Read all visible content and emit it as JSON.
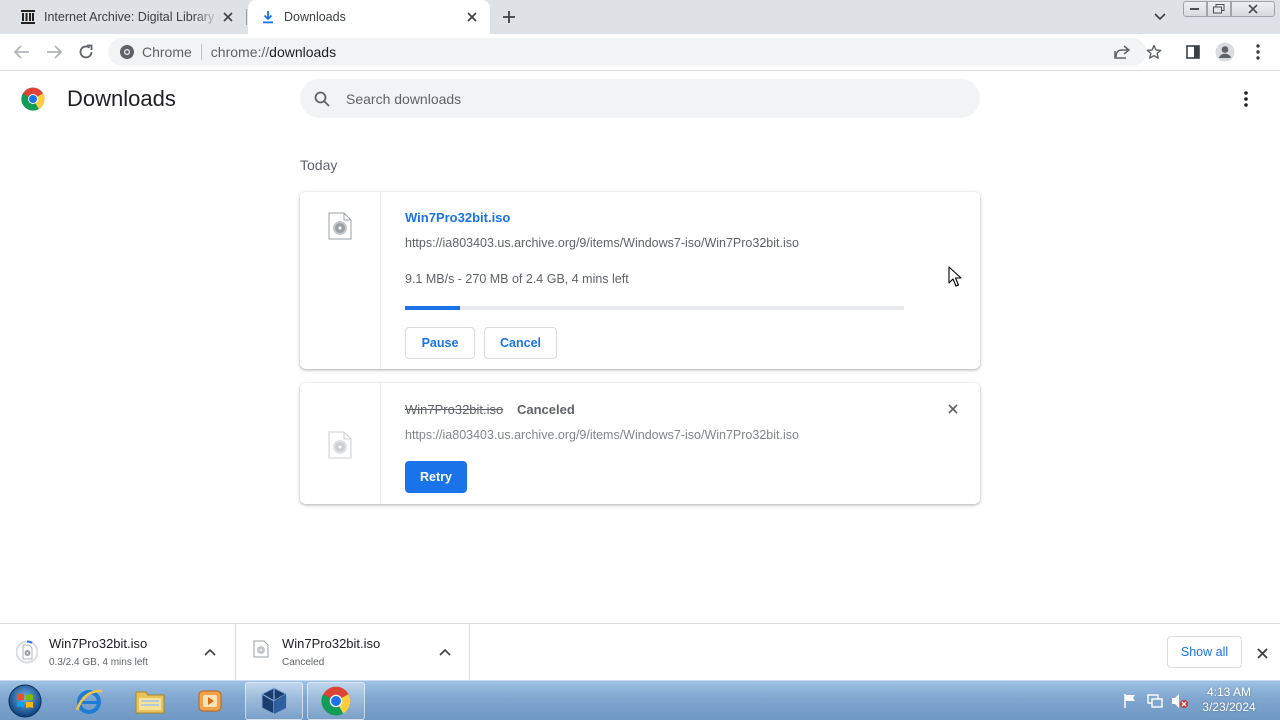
{
  "browser": {
    "tabs": [
      {
        "title": "Internet Archive: Digital Library of Free & Borrowable Books, Movies, Music & Wayback Machine",
        "active": false,
        "icon": "archive-icon"
      },
      {
        "title": "Downloads",
        "active": true,
        "icon": "download-icon"
      }
    ],
    "omnibox": {
      "scheme_label": "Chrome",
      "url_prefix": "chrome://",
      "url_host": "downloads"
    }
  },
  "page": {
    "title": "Downloads",
    "search_placeholder": "Search downloads",
    "date_heading": "Today",
    "downloads": [
      {
        "filename": "Win7Pro32bit.iso",
        "url": "https://ia803403.us.archive.org/9/items/Windows7-iso/Win7Pro32bit.iso",
        "status_text": "9.1 MB/s - 270 MB of 2.4 GB, 4 mins left",
        "progress_fraction": 0.11,
        "pause_label": "Pause",
        "cancel_label": "Cancel"
      },
      {
        "filename": "Win7Pro32bit.iso",
        "tag": "Canceled",
        "url": "https://ia803403.us.archive.org/9/items/Windows7-iso/Win7Pro32bit.iso",
        "retry_label": "Retry"
      }
    ]
  },
  "shelf": {
    "items": [
      {
        "name": "Win7Pro32bit.iso",
        "status": "0.3/2.4 GB, 4 mins left"
      },
      {
        "name": "Win7Pro32bit.iso",
        "status": "Canceled"
      }
    ],
    "show_all_label": "Show all"
  },
  "taskbar": {
    "apps": [
      "internet-explorer",
      "windows-explorer",
      "media-player",
      "virtualbox",
      "chrome"
    ],
    "time": "4:13 AM",
    "date": "3/23/2024"
  },
  "colors": {
    "accent": "#1a73e8",
    "text_secondary": "#5f6368",
    "tabstrip": "#dee1e6"
  }
}
